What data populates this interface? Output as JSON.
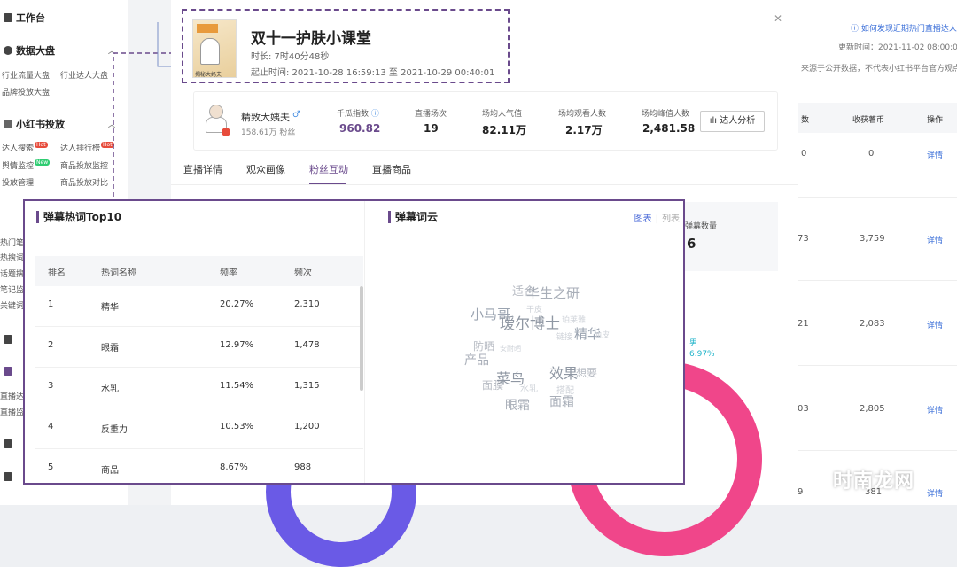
{
  "sidebar": {
    "workbench": "工作台",
    "data_market": {
      "title": "数据大盘",
      "items": [
        "行业流量大盘",
        "行业达人大盘",
        "品牌投放大盘"
      ]
    },
    "xhs_ads": {
      "title": "小红书投放",
      "items": [
        "达人搜索",
        "达人排行榜",
        "舆情监控",
        "商品投放监控",
        "投放管理",
        "商品投放对比"
      ],
      "hot": "Hot",
      "new": "New"
    },
    "partial_items": [
      "热门笔",
      "热搜词",
      "话题搜",
      "笔记监",
      "关键词",
      "直播达",
      "直播监"
    ]
  },
  "right_bg": {
    "help_link": "如何发现近期热门直播达人",
    "updated": "更新时间：2021-11-02 08:00:00",
    "disclaimer": "来源于公开数据，不代表小红书平台官方观点",
    "col_count": "数",
    "col_fav": "收获薯币",
    "col_op": "操作",
    "rows": [
      {
        "count": "0",
        "fav": "0",
        "op": "详情"
      },
      {
        "count": "73",
        "fav": "3,759",
        "op": "详情"
      },
      {
        "count": "21",
        "fav": "2,083",
        "op": "详情"
      },
      {
        "count": "03",
        "fav": "2,805",
        "op": "详情"
      },
      {
        "count": "9",
        "fav": "381",
        "op": "详情"
      }
    ]
  },
  "live": {
    "title": "双十一护肤小课堂",
    "duration": "时长: 7时40分48秒",
    "time_range": "起止时间: 2021-10-28 16:59:13 至 2021-10-29 00:40:01",
    "thumb_caption": "揭秘大妈夫"
  },
  "author": {
    "name": "精致大姨夫",
    "gender": "♂",
    "fans": "158.61万 粉丝"
  },
  "stats": [
    {
      "label": "千瓜指数",
      "value": "960.82"
    },
    {
      "label": "直播场次",
      "value": "19"
    },
    {
      "label": "场均人气值",
      "value": "82.11万"
    },
    {
      "label": "场均观看人数",
      "value": "2.17万"
    },
    {
      "label": "场均峰值人数",
      "value": "2,481.58"
    }
  ],
  "analysis_btn": "达人分析",
  "tabs": [
    "直播详情",
    "观众画像",
    "粉丝互动",
    "直播商品"
  ],
  "bg_panel": {
    "label": "弹幕数量",
    "value": "6",
    "pct_label": "男",
    "pct_value": "6.97%"
  },
  "danmu_top10": {
    "title": "弹幕热词Top10",
    "columns": [
      "排名",
      "热词名称",
      "频率",
      "频次"
    ],
    "rows": [
      {
        "rank": "1",
        "word": "精华",
        "rate": "20.27%",
        "count": "2,310"
      },
      {
        "rank": "2",
        "word": "眼霜",
        "rate": "12.97%",
        "count": "1,478"
      },
      {
        "rank": "3",
        "word": "水乳",
        "rate": "11.54%",
        "count": "1,315"
      },
      {
        "rank": "4",
        "word": "反重力",
        "rate": "10.53%",
        "count": "1,200"
      },
      {
        "rank": "5",
        "word": "商品",
        "rate": "8.67%",
        "count": "988"
      }
    ]
  },
  "wordcloud": {
    "title": "弹幕词云",
    "view_chart": "图表",
    "view_list": "列表",
    "words": [
      {
        "text": "适合",
        "color": "#b8bcc4",
        "size": 13
      },
      {
        "text": "华生之研",
        "color": "#a8aeb8",
        "size": 15
      },
      {
        "text": "小马哥",
        "color": "#9aa3b0",
        "size": 15
      },
      {
        "text": "干皮",
        "color": "#cfd3d9",
        "size": 9
      },
      {
        "text": "珀莱雅",
        "color": "#cfd3d9",
        "size": 9
      },
      {
        "text": "瑷尔博士",
        "color": "#8f97a3",
        "size": 17
      },
      {
        "text": "精华",
        "color": "#9aa3b0",
        "size": 15
      },
      {
        "text": "油皮",
        "color": "#cfd3d9",
        "size": 9
      },
      {
        "text": "防晒",
        "color": "#b8bcc4",
        "size": 12
      },
      {
        "text": "链接",
        "color": "#cfd3d9",
        "size": 9
      },
      {
        "text": "产品",
        "color": "#a8aeb8",
        "size": 14
      },
      {
        "text": "安耐晒",
        "color": "#cfd3d9",
        "size": 8
      },
      {
        "text": "效果",
        "color": "#8f97a3",
        "size": 16
      },
      {
        "text": "想要",
        "color": "#b8bcc4",
        "size": 12
      },
      {
        "text": "面膜",
        "color": "#b8bcc4",
        "size": 12
      },
      {
        "text": "菜鸟",
        "color": "#8f97a3",
        "size": 16
      },
      {
        "text": "水乳",
        "color": "#cfd3d9",
        "size": 10
      },
      {
        "text": "搭配",
        "color": "#cfd3d9",
        "size": 10
      },
      {
        "text": "眼霜",
        "color": "#a8aeb8",
        "size": 14
      },
      {
        "text": "面霜",
        "color": "#a8aeb8",
        "size": 14
      }
    ]
  },
  "watermark": "时南龙网",
  "colors": {
    "accent": "#6a4a8c",
    "pink": "#f0468a",
    "blue": "#6a5ae6",
    "link": "#3b6fd8"
  }
}
